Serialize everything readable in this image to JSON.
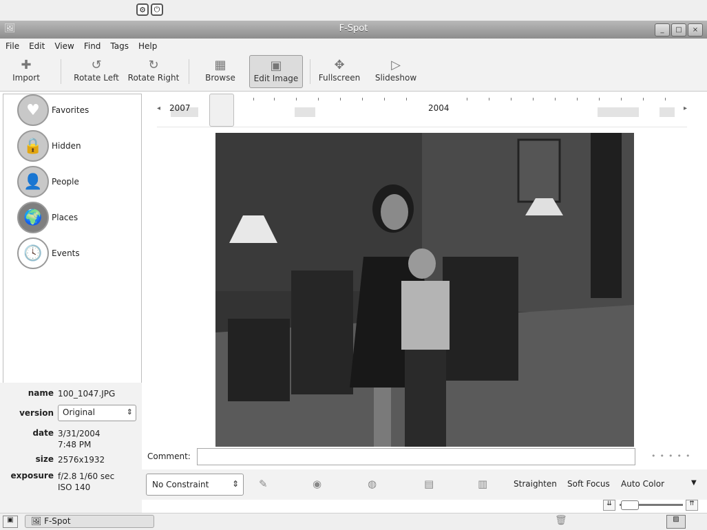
{
  "window": {
    "title": "F-Spot",
    "app_icon": "f-spot-icon",
    "controls": [
      "_",
      "□",
      "×"
    ]
  },
  "menubar": [
    "File",
    "Edit",
    "View",
    "Find",
    "Tags",
    "Help"
  ],
  "toolbar": {
    "import": "Import",
    "rotate_left": "Rotate Left",
    "rotate_right": "Rotate Right",
    "browse": "Browse",
    "edit_image": "Edit Image",
    "fullscreen": "Fullscreen",
    "slideshow": "Slideshow",
    "active": "Edit Image"
  },
  "sidebar": {
    "tags": [
      {
        "label": "Favorites",
        "icon": "heart-icon"
      },
      {
        "label": "Hidden",
        "icon": "lock-icon"
      },
      {
        "label": "People",
        "icon": "person-icon"
      },
      {
        "label": "Places",
        "icon": "globe-icon"
      },
      {
        "label": "Events",
        "icon": "clock-icon"
      }
    ]
  },
  "info": {
    "name_label": "name",
    "name_value": "100_1047.JPG",
    "version_label": "version",
    "version_value": "Original",
    "date_label": "date",
    "date_value": "3/31/2004",
    "time_value": "7:48 PM",
    "size_label": "size",
    "size_value": "2576x1932",
    "exposure_label": "exposure",
    "exposure_value": "f/2.8 1/60 sec",
    "iso_value": "ISO 140"
  },
  "timeline": {
    "year_left": "2007",
    "year_mid": "2004"
  },
  "comment": {
    "label": "Comment:",
    "value": ""
  },
  "edit_toolbar": {
    "constraint": "No Constraint",
    "straighten": "Straighten",
    "soft_focus": "Soft Focus",
    "auto_color": "Auto Color"
  },
  "taskbar": {
    "window_button": "F-Spot"
  }
}
